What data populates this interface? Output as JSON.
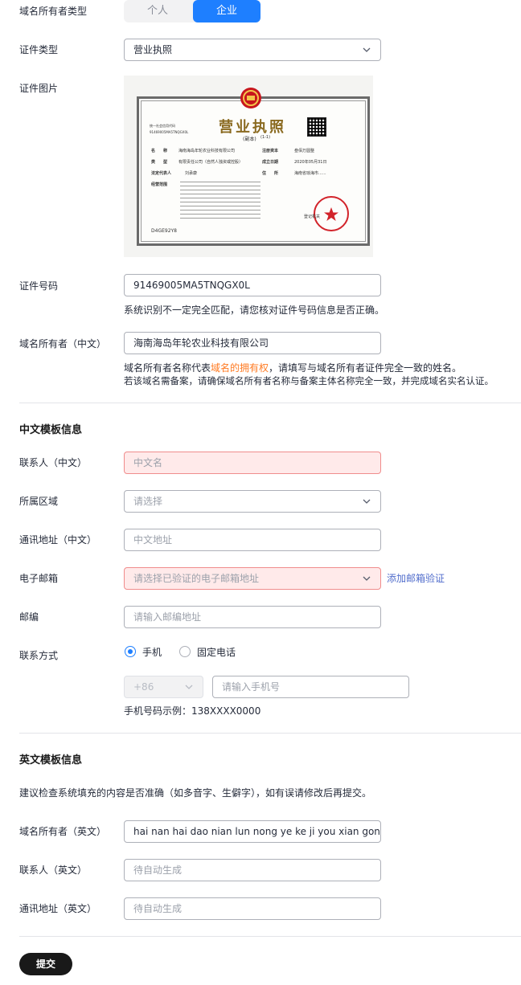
{
  "owner_type": {
    "label": "域名所有者类型",
    "options": [
      "个人",
      "企业"
    ],
    "selected": "企业"
  },
  "cert_type": {
    "label": "证件类型",
    "value": "营业执照"
  },
  "cert_image": {
    "label": "证件图片",
    "license": {
      "title": "营业执照",
      "copy": "(副本)",
      "copy_no": "(1-1)",
      "code_label": "统一社会信用代码",
      "code": "91469005MA5TNQGX0L",
      "name_label": "名　　称",
      "name_value": "海南海岛年轮农业科技有限公司",
      "type_label": "类　　型",
      "type_value": "有限责任公司（自然人独资或控股）",
      "rep_label": "法定代表人",
      "rep_value": "刘承康",
      "scope_label": "经营范围",
      "capital_label": "注册资本",
      "capital_value": "叁佰万圆整",
      "date_label": "成立日期",
      "date_value": "2020年05月31日",
      "addr_label": "住　　所",
      "addr_value": "海南省琼海市......",
      "authority": "登记机关",
      "serial": "D4GE92Y8"
    }
  },
  "cert_number": {
    "label": "证件号码",
    "value": "91469005MA5TNQGX0L",
    "hint": "系统识别不一定完全匹配，请您核对证件号码信息是否正确。"
  },
  "owner_cn": {
    "label": "域名所有者（中文）",
    "value": "海南海岛年轮农业科技有限公司",
    "hint1_pre": "域名所有者名称代表",
    "hint1_highlight": "域名的拥有权",
    "hint1_post": "，请填写与域名所有者证件完全一致的姓名。",
    "hint2": "若该域名需备案，请确保域名所有者名称与备案主体名称完全一致，并完成域名实名认证。"
  },
  "cn_template": {
    "title": "中文模板信息",
    "contact": {
      "label": "联系人（中文）",
      "placeholder": "中文名"
    },
    "region": {
      "label": "所属区域",
      "placeholder": "请选择"
    },
    "address": {
      "label": "通讯地址（中文）",
      "placeholder": "中文地址"
    },
    "email": {
      "label": "电子邮箱",
      "placeholder": "请选择已验证的电子邮箱地址",
      "link": "添加邮箱验证"
    },
    "postcode": {
      "label": "邮编",
      "placeholder": "请输入邮编地址"
    },
    "contact_method": {
      "label": "联系方式",
      "options": [
        "手机",
        "固定电话"
      ],
      "selected": "手机",
      "country_code": "+86",
      "phone_placeholder": "请输入手机号",
      "example": "手机号码示例：138XXXX0000"
    }
  },
  "en_template": {
    "title": "英文模板信息",
    "note": "建议检查系统填充的内容是否准确（如多音字、生僻字），如有误请修改后再提交。",
    "owner": {
      "label": "域名所有者（英文）",
      "value": "hai nan hai dao nian lun nong ye ke ji you xian gong si"
    },
    "contact": {
      "label": "联系人（英文）",
      "placeholder": "待自动生成"
    },
    "address": {
      "label": "通讯地址（英文）",
      "placeholder": "待自动生成"
    }
  },
  "submit_label": "提交",
  "colors": {
    "primary": "#1e7fff",
    "error_bg": "#ffeaea",
    "error_border": "#f08c8c",
    "link": "#526ecc",
    "highlight": "#ff7a21",
    "submit": "#191919"
  }
}
